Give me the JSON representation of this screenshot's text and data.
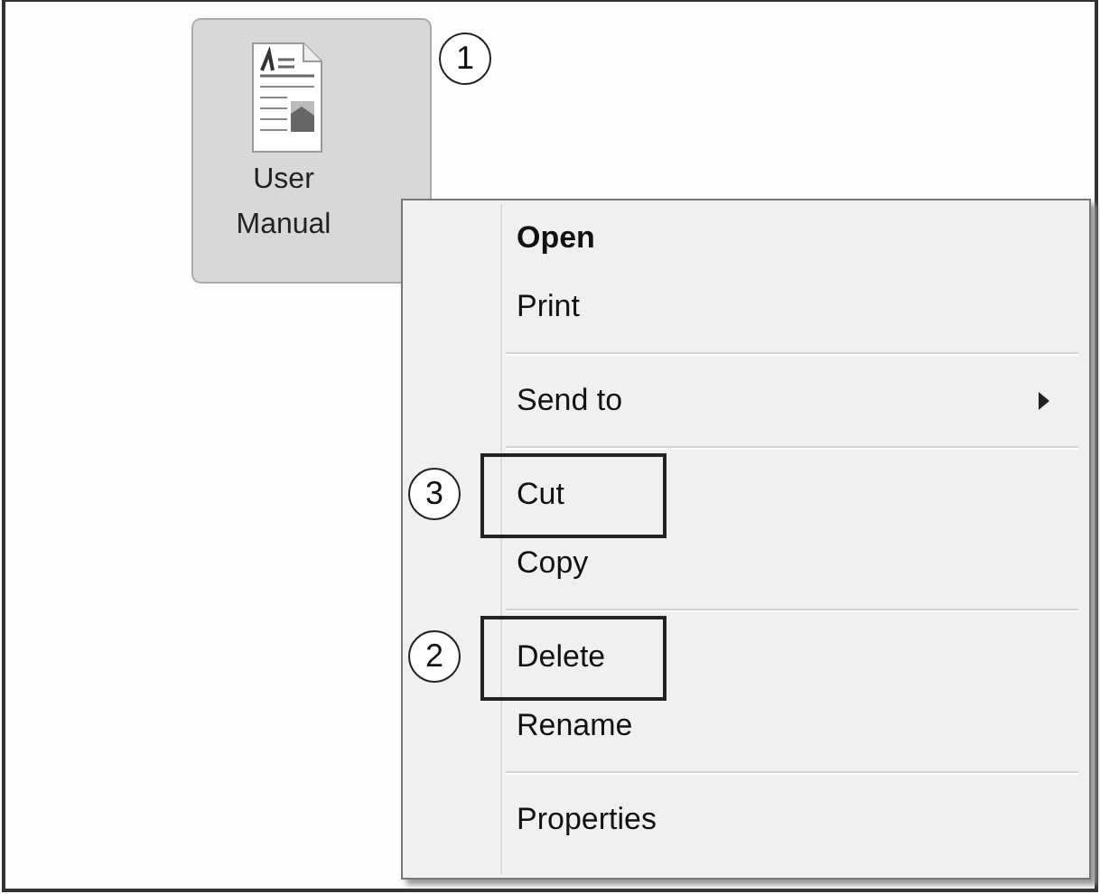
{
  "desktop_icon": {
    "label": "User Manual",
    "selected": true,
    "callout": "1"
  },
  "context_menu": {
    "items": [
      {
        "kind": "item",
        "label": "Open",
        "default": true,
        "submenu": false,
        "highlighted": false
      },
      {
        "kind": "item",
        "label": "Print",
        "default": false,
        "submenu": false,
        "highlighted": false
      },
      {
        "kind": "separator"
      },
      {
        "kind": "item",
        "label": "Send to",
        "default": false,
        "submenu": true,
        "highlighted": false
      },
      {
        "kind": "separator"
      },
      {
        "kind": "item",
        "label": "Cut",
        "default": false,
        "submenu": false,
        "highlighted": true,
        "callout": "3"
      },
      {
        "kind": "item",
        "label": "Copy",
        "default": false,
        "submenu": false,
        "highlighted": false
      },
      {
        "kind": "separator"
      },
      {
        "kind": "item",
        "label": "Delete",
        "default": false,
        "submenu": false,
        "highlighted": true,
        "callout": "2"
      },
      {
        "kind": "item",
        "label": "Rename",
        "default": false,
        "submenu": false,
        "highlighted": false
      },
      {
        "kind": "separator"
      },
      {
        "kind": "item",
        "label": "Properties",
        "default": false,
        "submenu": false,
        "highlighted": false
      }
    ]
  }
}
